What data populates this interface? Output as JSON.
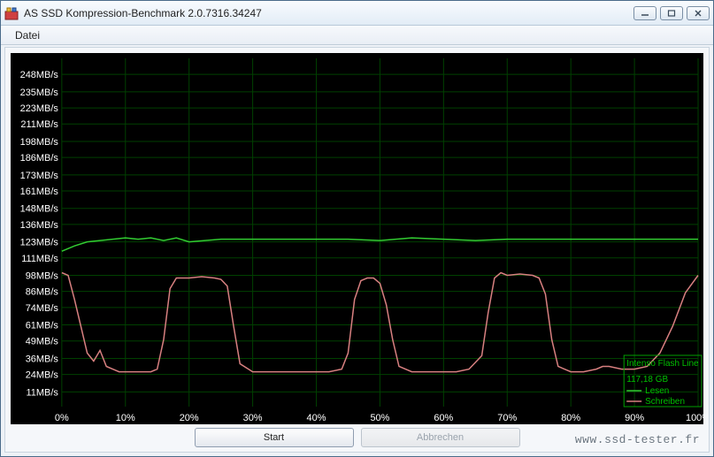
{
  "window": {
    "title": "AS SSD Kompression-Benchmark 2.0.7316.34247"
  },
  "menubar": {
    "file": "Datei"
  },
  "buttons": {
    "start": "Start",
    "cancel": "Abbrechen"
  },
  "legend": {
    "device": "Intenso Flash Line",
    "capacity": "117,18 GB",
    "read": "Lesen",
    "write": "Schreiben"
  },
  "watermark": "www.ssd-tester.fr",
  "chart_data": {
    "type": "line",
    "xlabel": "",
    "ylabel": "",
    "x_categories": [
      "0%",
      "10%",
      "20%",
      "30%",
      "40%",
      "50%",
      "60%",
      "70%",
      "80%",
      "90%",
      "100%"
    ],
    "y_ticks": [
      "11MB/s",
      "24MB/s",
      "36MB/s",
      "49MB/s",
      "61MB/s",
      "74MB/s",
      "86MB/s",
      "98MB/s",
      "111MB/s",
      "123MB/s",
      "136MB/s",
      "148MB/s",
      "161MB/s",
      "173MB/s",
      "186MB/s",
      "198MB/s",
      "211MB/s",
      "223MB/s",
      "235MB/s",
      "248MB/s"
    ],
    "xlim": [
      0,
      100
    ],
    "ylim": [
      0,
      260
    ],
    "series": [
      {
        "name": "Lesen",
        "color": "#32cd32",
        "x": [
          0,
          2,
          4,
          6,
          8,
          10,
          12,
          14,
          16,
          18,
          20,
          25,
          30,
          35,
          40,
          45,
          50,
          55,
          60,
          65,
          70,
          75,
          80,
          85,
          90,
          95,
          100
        ],
        "values": [
          116,
          120,
          123,
          124,
          125,
          126,
          125,
          126,
          124,
          126,
          123,
          125,
          125,
          125,
          125,
          125,
          124,
          126,
          125,
          124,
          125,
          125,
          125,
          125,
          125,
          125,
          125
        ]
      },
      {
        "name": "Schreiben",
        "color": "#d88080",
        "x": [
          0,
          1,
          2,
          3,
          4,
          5,
          6,
          7,
          8,
          9,
          10,
          12,
          14,
          15,
          16,
          17,
          18,
          20,
          22,
          24,
          25,
          26,
          27,
          28,
          30,
          32,
          34,
          36,
          38,
          40,
          42,
          44,
          45,
          46,
          47,
          48,
          49,
          50,
          51,
          52,
          53,
          55,
          58,
          60,
          62,
          64,
          66,
          67,
          68,
          69,
          70,
          72,
          74,
          75,
          76,
          77,
          78,
          80,
          82,
          84,
          85,
          86,
          88,
          90,
          92,
          94,
          96,
          98,
          100
        ],
        "values": [
          100,
          98,
          80,
          60,
          40,
          34,
          42,
          30,
          28,
          26,
          26,
          26,
          26,
          28,
          50,
          88,
          96,
          96,
          97,
          96,
          95,
          90,
          60,
          32,
          26,
          26,
          26,
          26,
          26,
          26,
          26,
          28,
          40,
          80,
          94,
          96,
          96,
          92,
          76,
          50,
          30,
          26,
          26,
          26,
          26,
          28,
          38,
          70,
          96,
          100,
          98,
          99,
          98,
          96,
          84,
          50,
          30,
          26,
          26,
          28,
          30,
          30,
          28,
          28,
          30,
          40,
          60,
          85,
          98
        ]
      }
    ]
  }
}
